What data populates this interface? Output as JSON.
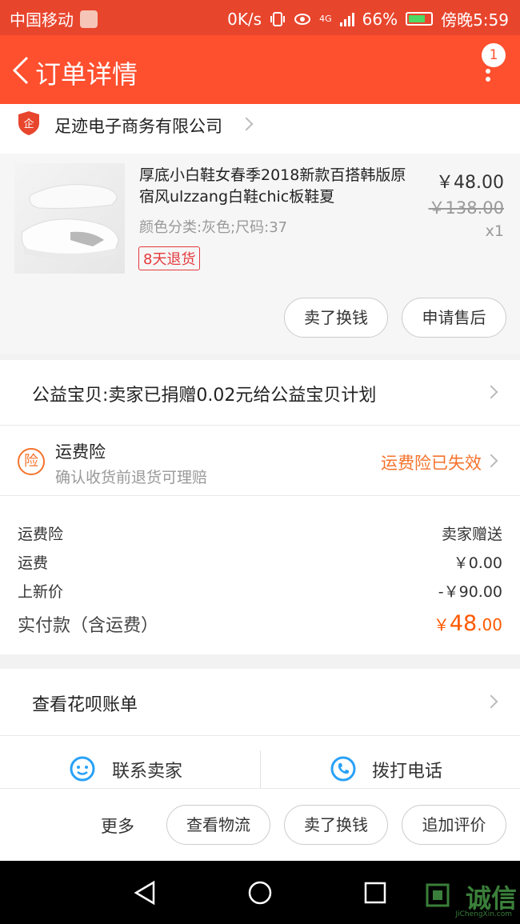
{
  "status_bar": {
    "carrier": "中国移动",
    "speed": "0K/s",
    "network": "4G",
    "battery": "66%",
    "time": "傍晚5:59"
  },
  "nav": {
    "title": "订单详情",
    "badge": "1"
  },
  "shop": {
    "icon_glyph": "企",
    "name": "足迹电子商务有限公司"
  },
  "product": {
    "title": "厚底小白鞋女春季2018新款百搭韩版原宿风ulzzang白鞋chic板鞋夏",
    "spec": "颜色分类:灰色;尺码:37",
    "return_tag": "8天退货",
    "price": "￥48.00",
    "original_price": "￥138.00",
    "quantity": "x1",
    "buttons": [
      "卖了换钱",
      "申请售后"
    ]
  },
  "charity": {
    "text": "公益宝贝:卖家已捐赠0.02元给公益宝贝计划"
  },
  "insurance": {
    "icon_glyph": "险",
    "title": "运费险",
    "subtitle": "确认收货前退货可理赔",
    "status": "运费险已失效",
    "status_color": "#f5732c"
  },
  "costs": {
    "rows": [
      {
        "label": "运费险",
        "value": "卖家赠送"
      },
      {
        "label": "运费",
        "value": "￥0.00"
      },
      {
        "label": "上新价",
        "value": "-￥90.00"
      }
    ],
    "total_label": "实付款（含运费）",
    "total_currency": "￥",
    "total_int": "48",
    "total_dec": ".00",
    "total_color": "#fe5a00"
  },
  "huabei": {
    "text": "查看花呗账单"
  },
  "contact": {
    "seller": "联系卖家",
    "phone": "拨打电话"
  },
  "actions": {
    "more": "更多",
    "buttons": [
      "查看物流",
      "卖了换钱",
      "追加评价"
    ]
  },
  "watermark": {
    "text": "诚信",
    "sub": "JiChengXin.com"
  },
  "colors": {
    "nav_bg": "#fe4f2e",
    "accent": "#f5732c",
    "icon_blue": "#29a1f7"
  }
}
